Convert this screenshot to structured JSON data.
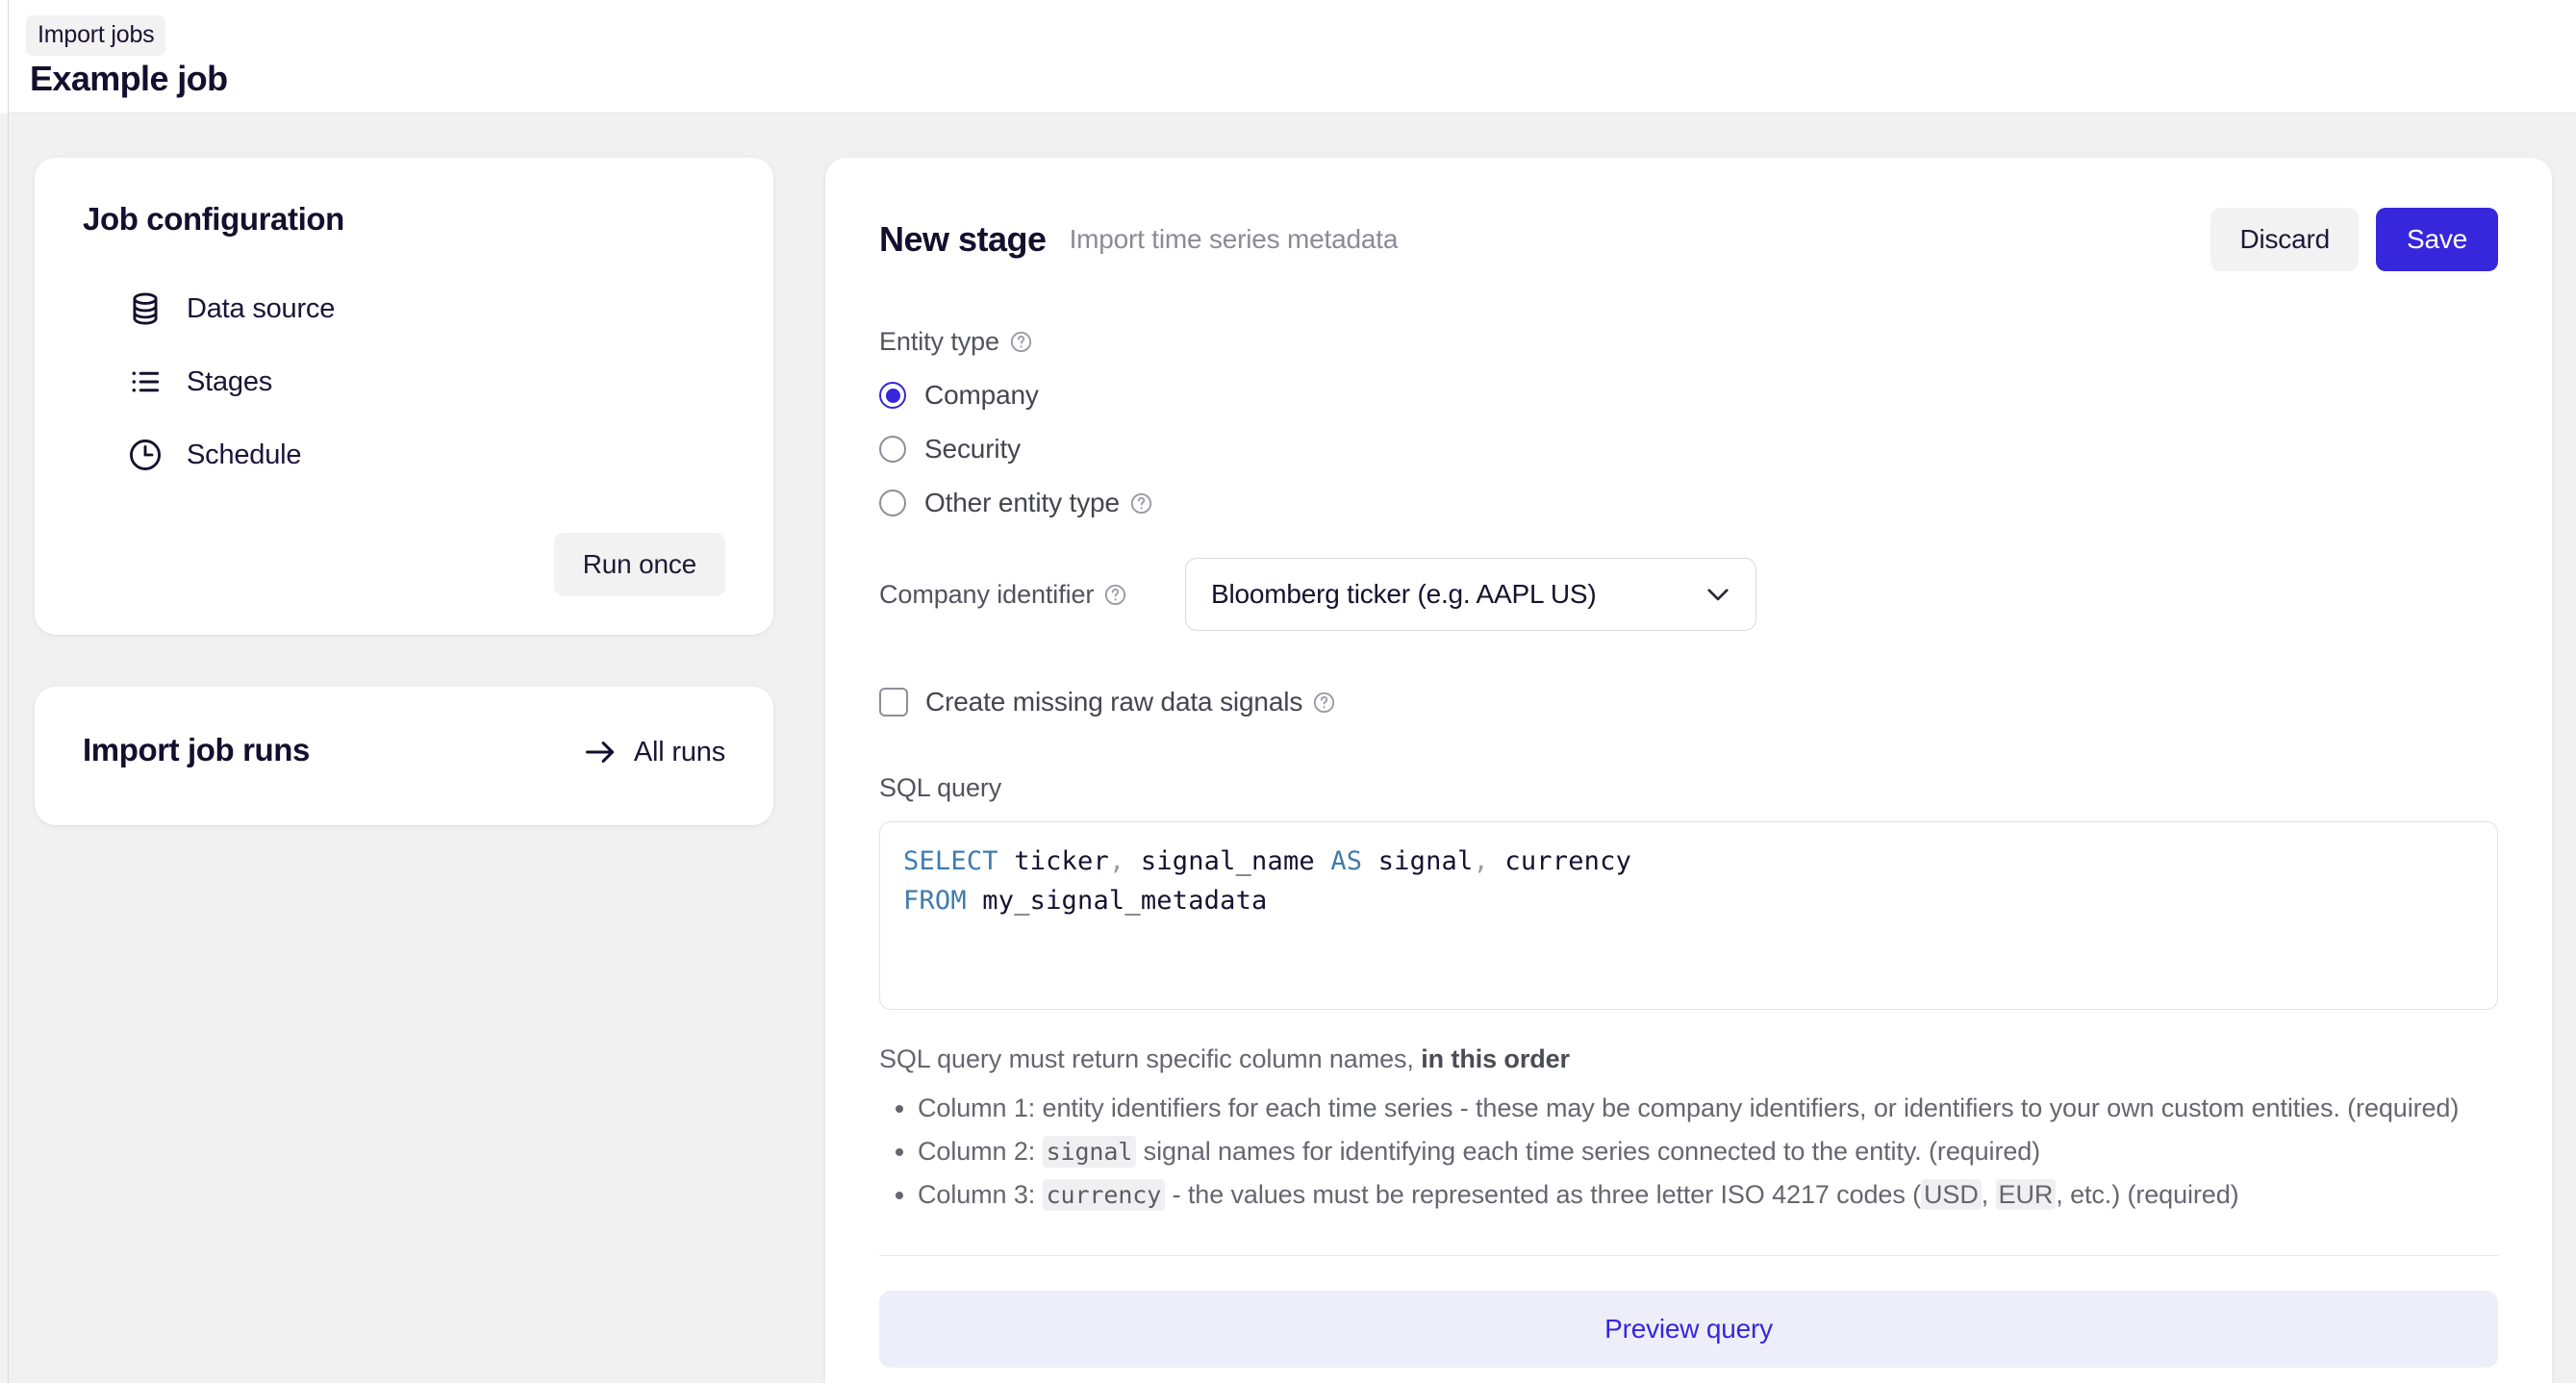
{
  "header": {
    "breadcrumb": "Import jobs",
    "title": "Example job"
  },
  "sidebar": {
    "job_config": {
      "title": "Job configuration",
      "items": [
        {
          "label": "Data source",
          "icon": "database-icon"
        },
        {
          "label": "Stages",
          "icon": "list-icon"
        },
        {
          "label": "Schedule",
          "icon": "clock-icon"
        }
      ],
      "run_once_label": "Run once"
    },
    "job_runs": {
      "title": "Import job runs",
      "all_runs_label": "All runs"
    }
  },
  "stage": {
    "title": "New stage",
    "subtitle": "Import time series metadata",
    "discard_label": "Discard",
    "save_label": "Save",
    "entity_type": {
      "label": "Entity type",
      "options": [
        {
          "label": "Company",
          "selected": true,
          "help": false
        },
        {
          "label": "Security",
          "selected": false,
          "help": false
        },
        {
          "label": "Other entity type",
          "selected": false,
          "help": true
        }
      ]
    },
    "company_identifier": {
      "label": "Company identifier",
      "value": "Bloomberg ticker (e.g. AAPL US)"
    },
    "create_missing_signals": {
      "label": "Create missing raw data signals",
      "checked": false
    },
    "sql": {
      "label": "SQL query",
      "line1_kw1": "SELECT",
      "line1_a": " ticker",
      "line1_c1": ",",
      "line1_b": " signal_name ",
      "line1_kw2": "AS",
      "line1_d": " signal",
      "line1_c2": ",",
      "line1_e": " currency",
      "line2_kw": "FROM",
      "line2_a": " my_signal_metadata"
    },
    "hints": {
      "title_plain": "SQL query must return specific column names, ",
      "title_bold": "in this order",
      "bullet1": "Column 1: entity identifiers for each time series - these may be company identifiers, or identifiers to your own custom entities. (required)",
      "bullet2_pre": "Column 2: ",
      "bullet2_code": "signal",
      "bullet2_post": " signal names for identifying each time series connected to the entity. (required)",
      "bullet3_pre": "Column 3: ",
      "bullet3_code": "currency",
      "bullet3_mid": " - the values must be represented as three letter ISO 4217 codes (",
      "bullet3_usd": "USD",
      "bullet3_sep": ", ",
      "bullet3_eur": "EUR",
      "bullet3_post": ", etc.) (required)"
    },
    "preview_label": "Preview query"
  },
  "colors": {
    "accent": "#3626dc",
    "accent_soft_bg": "#eeeefa",
    "page_bg": "#f1f1f2",
    "text_dark": "#150f2e",
    "text_muted": "#666670",
    "sql_keyword": "#3f7cad"
  }
}
